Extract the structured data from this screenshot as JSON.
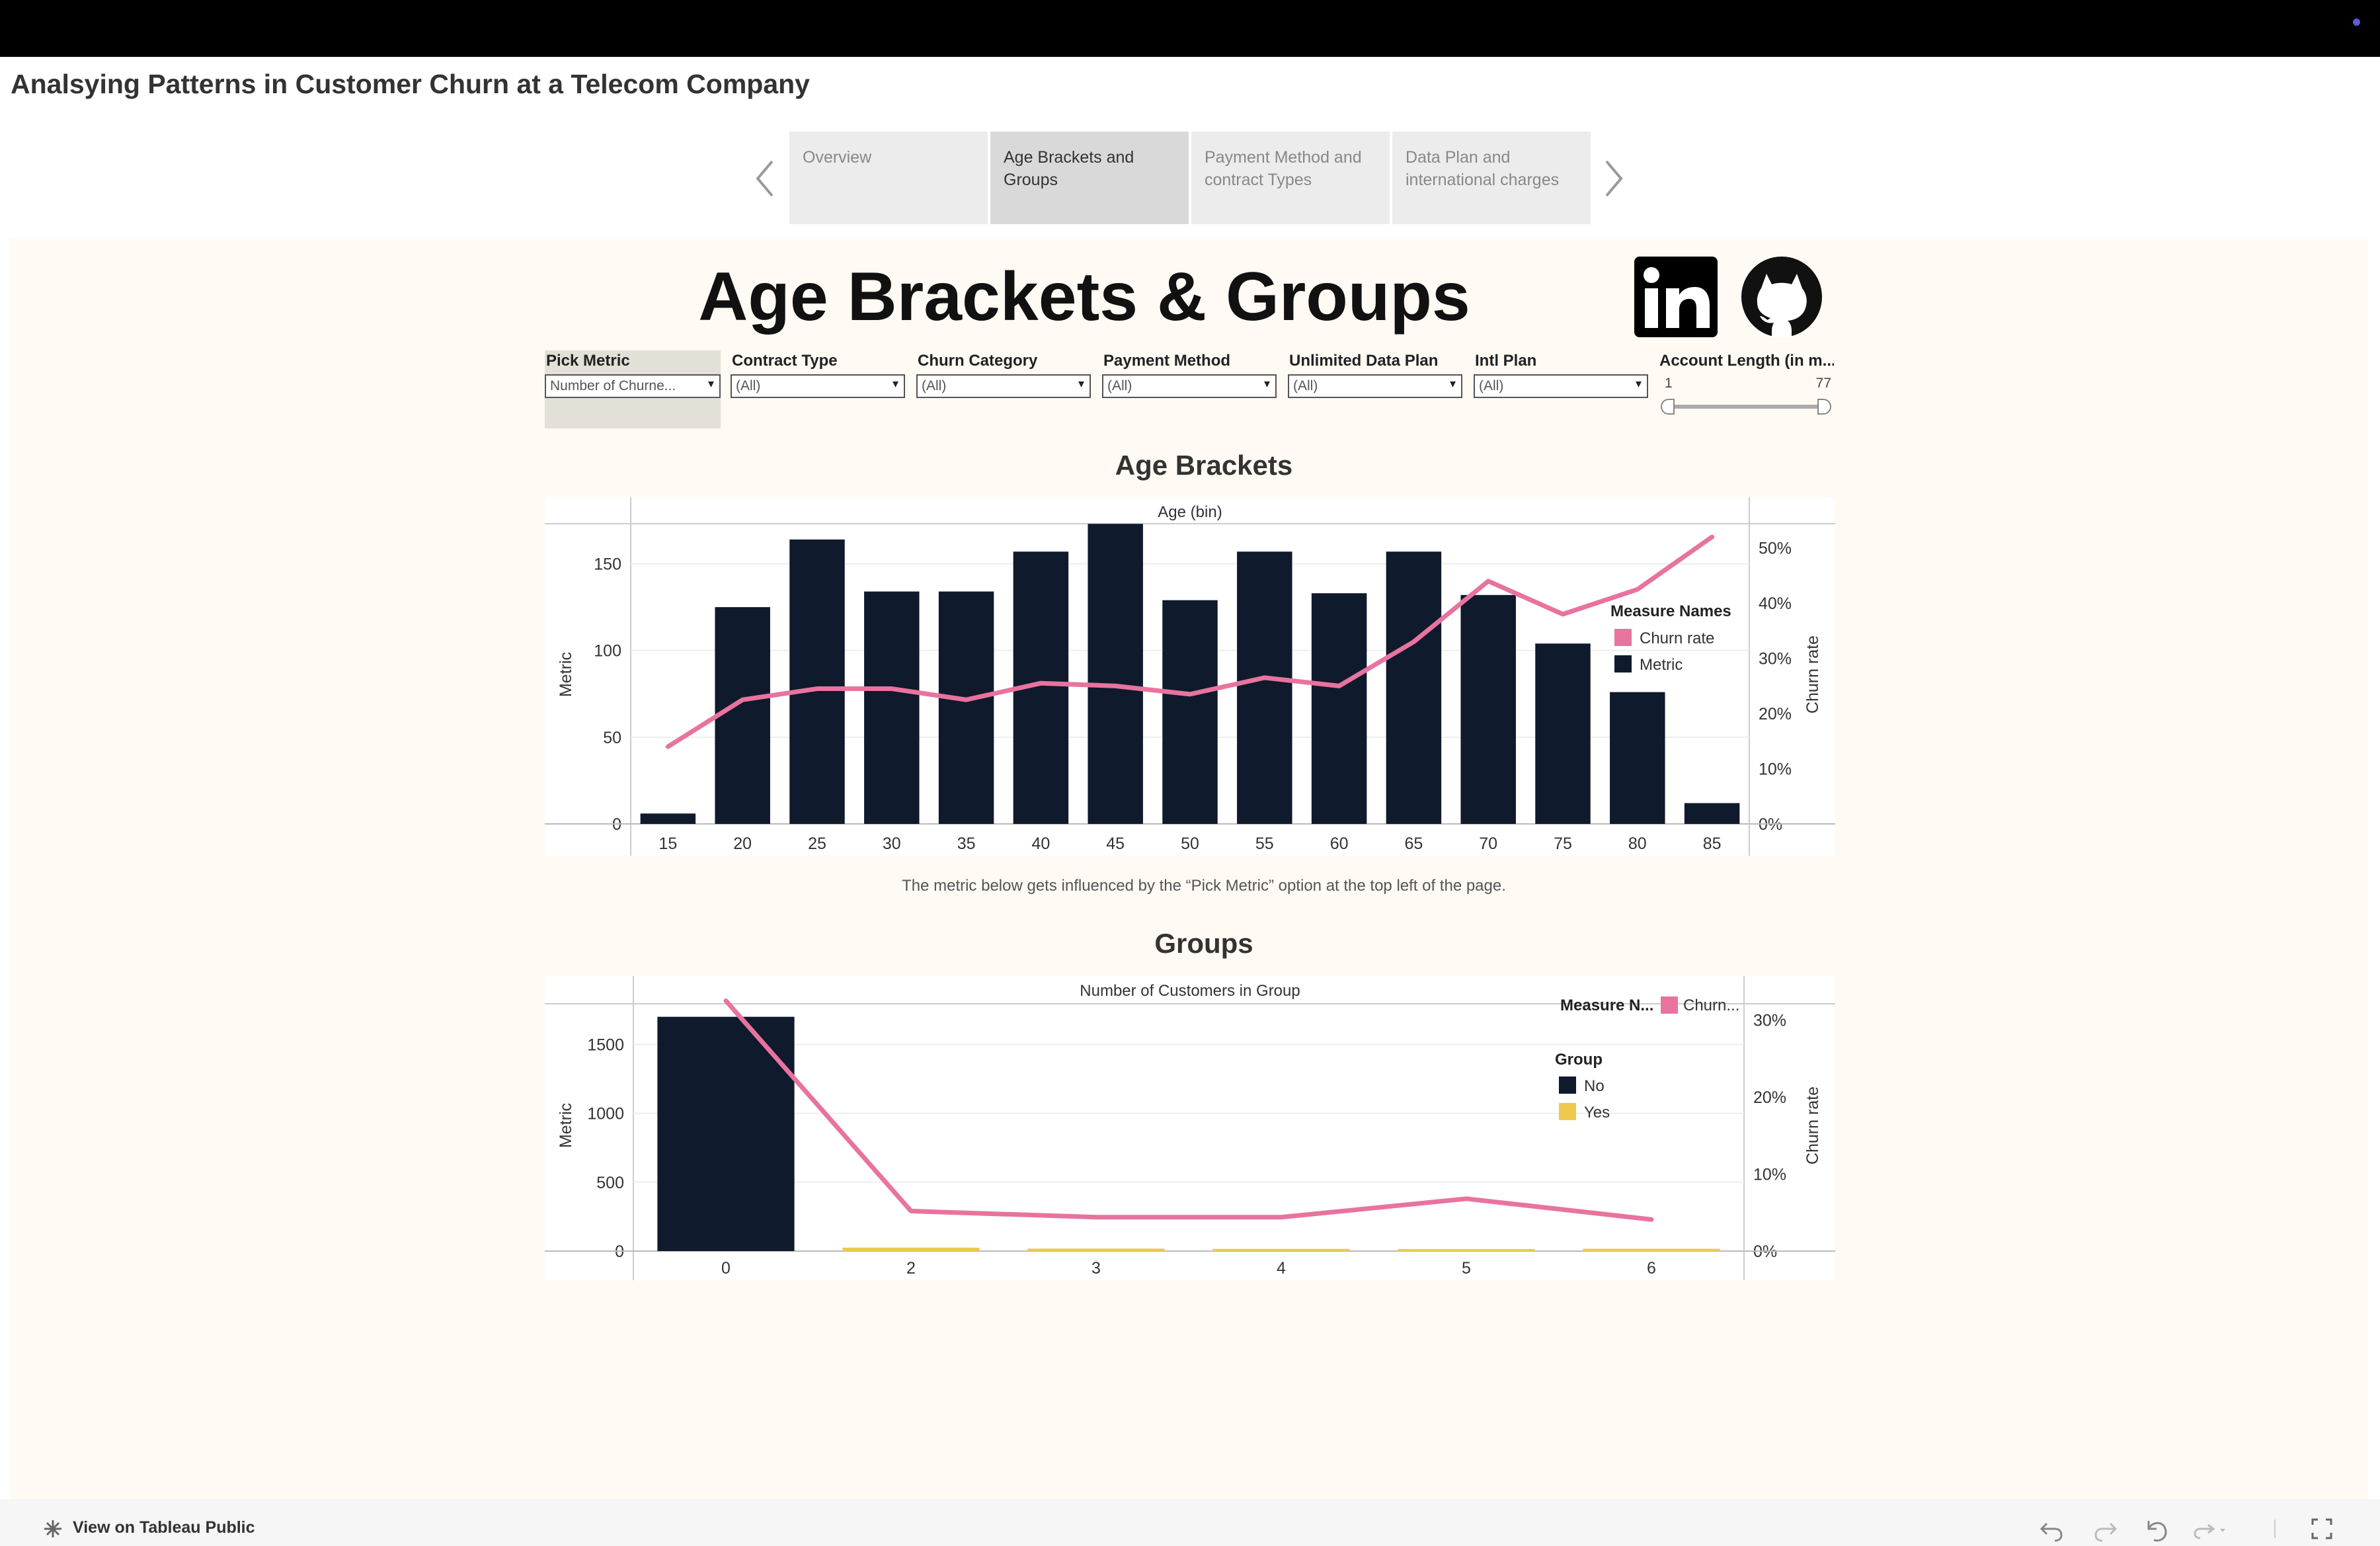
{
  "page": {
    "title": "Analsying Patterns in Customer Churn at a Telecom Company",
    "tabs": [
      {
        "label_line1": "Overview",
        "label_line2": ""
      },
      {
        "label_line1": "Age Brackets and",
        "label_line2": "Groups"
      },
      {
        "label_line1": "Payment Method and",
        "label_line2": "contract Types"
      },
      {
        "label_line1": "Data Plan and",
        "label_line2": "international charges"
      }
    ],
    "active_tab": 1
  },
  "dashboard": {
    "title": "Age Brackets & Groups",
    "social_icons": [
      "linkedin-icon",
      "github-icon"
    ]
  },
  "filters": {
    "pick_metric": {
      "label": "Pick Metric",
      "value": "Number of Churne..."
    },
    "contract_type": {
      "label": "Contract Type",
      "value": "(All)"
    },
    "churn_category": {
      "label": "Churn Category",
      "value": "(All)"
    },
    "payment_method": {
      "label": "Payment Method",
      "value": "(All)"
    },
    "unlimited_data_plan": {
      "label": "Unlimited Data Plan",
      "value": "(All)"
    },
    "intl_plan": {
      "label": "Intl Plan",
      "value": "(All)"
    },
    "account_length": {
      "label": "Account Length (in m...",
      "min": "1",
      "max": "77",
      "range": [
        1,
        77
      ]
    }
  },
  "sections": {
    "age_title": "Age Brackets",
    "groups_title": "Groups",
    "note": "The metric below gets influenced by the “Pick Metric” option at the top left of the page."
  },
  "chart_data": [
    {
      "type": "bar",
      "title": "Age Brackets",
      "header": "Age (bin)",
      "categories": [
        "15",
        "20",
        "25",
        "30",
        "35",
        "40",
        "45",
        "50",
        "55",
        "60",
        "65",
        "70",
        "75",
        "80",
        "85"
      ],
      "ylabel": "Metric",
      "ylabel_right": "Churn rate",
      "ylim": [
        0,
        175
      ],
      "yticks": [
        0,
        50,
        100,
        150
      ],
      "y2lim": [
        0,
        55
      ],
      "y2ticks": [
        "0%",
        "10%",
        "20%",
        "30%",
        "40%",
        "50%"
      ],
      "legend_title": "Measure Names",
      "series": [
        {
          "name": "Metric",
          "type": "bar",
          "color": "#0f1a2c",
          "values": [
            6,
            125,
            164,
            134,
            134,
            157,
            173,
            129,
            157,
            133,
            157,
            132,
            104,
            76,
            12
          ]
        },
        {
          "name": "Churn rate",
          "type": "line",
          "color": "#e8739f",
          "values": [
            14,
            22.5,
            24.5,
            24.5,
            22.5,
            25.5,
            25,
            23.5,
            26.5,
            25,
            33,
            44,
            38,
            42.5,
            52
          ]
        }
      ]
    },
    {
      "type": "bar",
      "title": "Groups",
      "header": "Number of Customers in Group",
      "categories": [
        "0",
        "2",
        "3",
        "4",
        "5",
        "6"
      ],
      "ylabel": "Metric",
      "ylabel_right": "Churn rate",
      "ylim": [
        0,
        1900
      ],
      "yticks": [
        0,
        500,
        1000,
        1500
      ],
      "y2lim": [
        0,
        34
      ],
      "y2ticks": [
        "0%",
        "10%",
        "20%",
        "30%"
      ],
      "legend_measure_title": "Measure N...",
      "legend_measure_item": "Churn...",
      "legend_group_title": "Group",
      "series": [
        {
          "name": "No",
          "type": "bar",
          "color": "#0f1a2c",
          "values": [
            1700,
            0,
            0,
            0,
            0,
            0
          ]
        },
        {
          "name": "Yes",
          "type": "bar",
          "color": "#efc94c",
          "values": [
            0,
            25,
            18,
            16,
            15,
            17
          ]
        },
        {
          "name": "Churn",
          "type": "line",
          "color": "#e8739f",
          "values": [
            32.5,
            5.2,
            4.4,
            4.4,
            6.8,
            4.1
          ]
        }
      ]
    }
  ],
  "footer": {
    "brand": "View on Tableau Public",
    "controls": [
      "undo-icon",
      "redo-icon",
      "revert-icon",
      "refresh-icon",
      "fullscreen-icon"
    ]
  }
}
